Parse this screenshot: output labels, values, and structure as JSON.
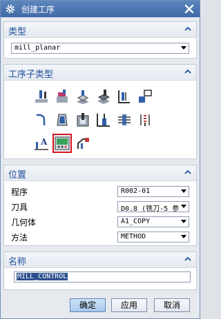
{
  "window": {
    "title": "创建工序",
    "icons": {
      "settings": "gear-icon",
      "close": "close-icon"
    }
  },
  "type_section": {
    "title": "类型",
    "value": "mill_planar"
  },
  "subtype_section": {
    "title": "工序子类型",
    "icons": [
      "face-milling-area-icon",
      "face-milling-icon",
      "face-milling-manual-icon",
      "planar-mill-icon",
      "planar-profile-icon",
      "clean-up-corners-icon",
      "finish-walls-icon",
      "finish-floor-icon",
      "groove-milling-icon",
      "hole-milling-icon",
      "boss-thread-milling-icon",
      "thread-milling-icon",
      "planar-text-icon",
      "mill-control-icon",
      "mill-user-icon"
    ],
    "selected_icon": "mill-control-icon",
    "accent": "#d7141a"
  },
  "position_section": {
    "title": "位置",
    "rows": [
      {
        "label": "程序",
        "value": "R002-01"
      },
      {
        "label": "刀具",
        "value": "D0.8 (铣刀-5 参"
      },
      {
        "label": "几何体",
        "value": "A1_COPY"
      },
      {
        "label": "方法",
        "value": "METHOD"
      }
    ]
  },
  "name_section": {
    "title": "名称",
    "value": "MILL_CONTROL"
  },
  "buttons": {
    "ok": "确定",
    "apply": "应用",
    "cancel": "取消"
  }
}
